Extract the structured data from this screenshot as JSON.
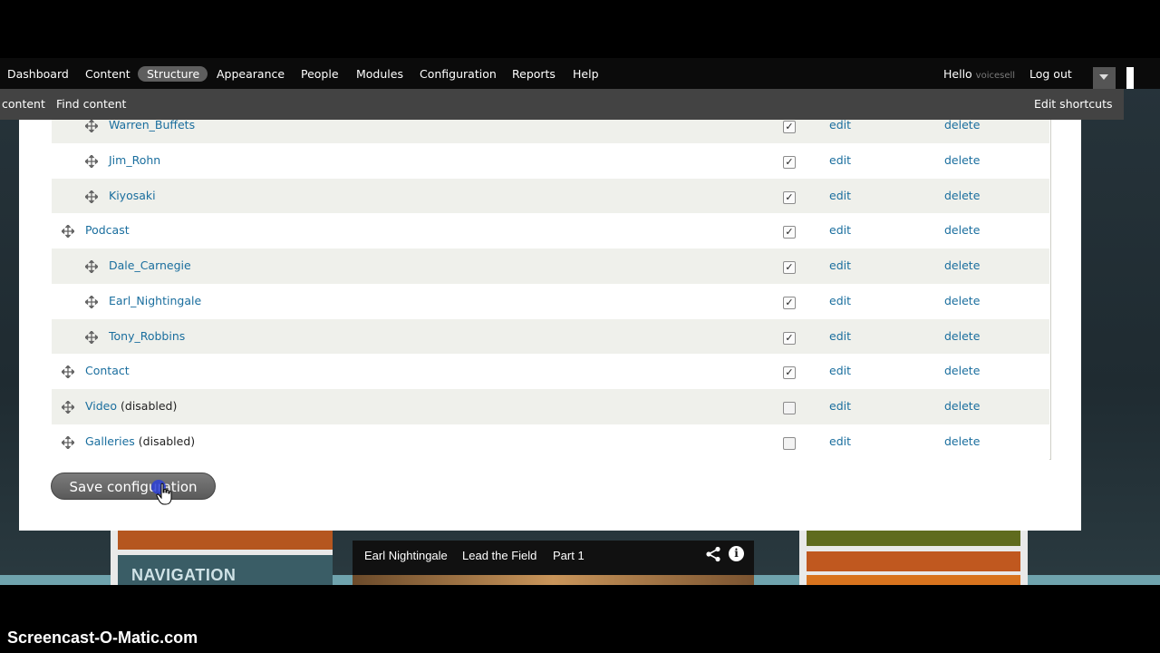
{
  "toolbar": {
    "items": [
      "Dashboard",
      "Content",
      "Structure",
      "Appearance",
      "People",
      "Modules",
      "Configuration",
      "Reports",
      "Help"
    ],
    "active": "Structure",
    "hello": "Hello",
    "username": "voicesell",
    "logout": "Log out"
  },
  "shortcuts": {
    "items": [
      "content",
      "Find content"
    ],
    "edit": "Edit shortcuts"
  },
  "menu_table": {
    "rows": [
      {
        "name": "Warren_Buffets",
        "suffix": "",
        "indent": 1,
        "enabled": true
      },
      {
        "name": "Jim_Rohn",
        "suffix": "",
        "indent": 1,
        "enabled": true
      },
      {
        "name": "Kiyosaki",
        "suffix": "",
        "indent": 1,
        "enabled": true
      },
      {
        "name": "Podcast",
        "suffix": "",
        "indent": 0,
        "enabled": true
      },
      {
        "name": "Dale_Carnegie",
        "suffix": "",
        "indent": 1,
        "enabled": true
      },
      {
        "name": "Earl_Nightingale",
        "suffix": "",
        "indent": 1,
        "enabled": true
      },
      {
        "name": "Tony_Robbins",
        "suffix": "",
        "indent": 1,
        "enabled": true
      },
      {
        "name": "Contact",
        "suffix": "",
        "indent": 0,
        "enabled": true
      },
      {
        "name": "Video",
        "suffix": "(disabled)",
        "indent": 0,
        "enabled": false
      },
      {
        "name": "Galleries",
        "suffix": "(disabled)",
        "indent": 0,
        "enabled": false
      }
    ],
    "edit_label": "edit",
    "delete_label": "delete"
  },
  "save_button": "Save configuration",
  "background": {
    "navigation_label": "NAVIGATION"
  },
  "video": {
    "title_parts": [
      "Earl Nightingale",
      "Lead the Field",
      "Part 1"
    ],
    "share_icon": "share-icon",
    "info_icon": "info-icon",
    "info_glyph": "i"
  },
  "watermark": "Screencast-O-Matic.com",
  "colors": {
    "link": "#1a6e9e",
    "toolbar_bg": "#0b0b0b",
    "shortcuts_bg": "#434343"
  }
}
